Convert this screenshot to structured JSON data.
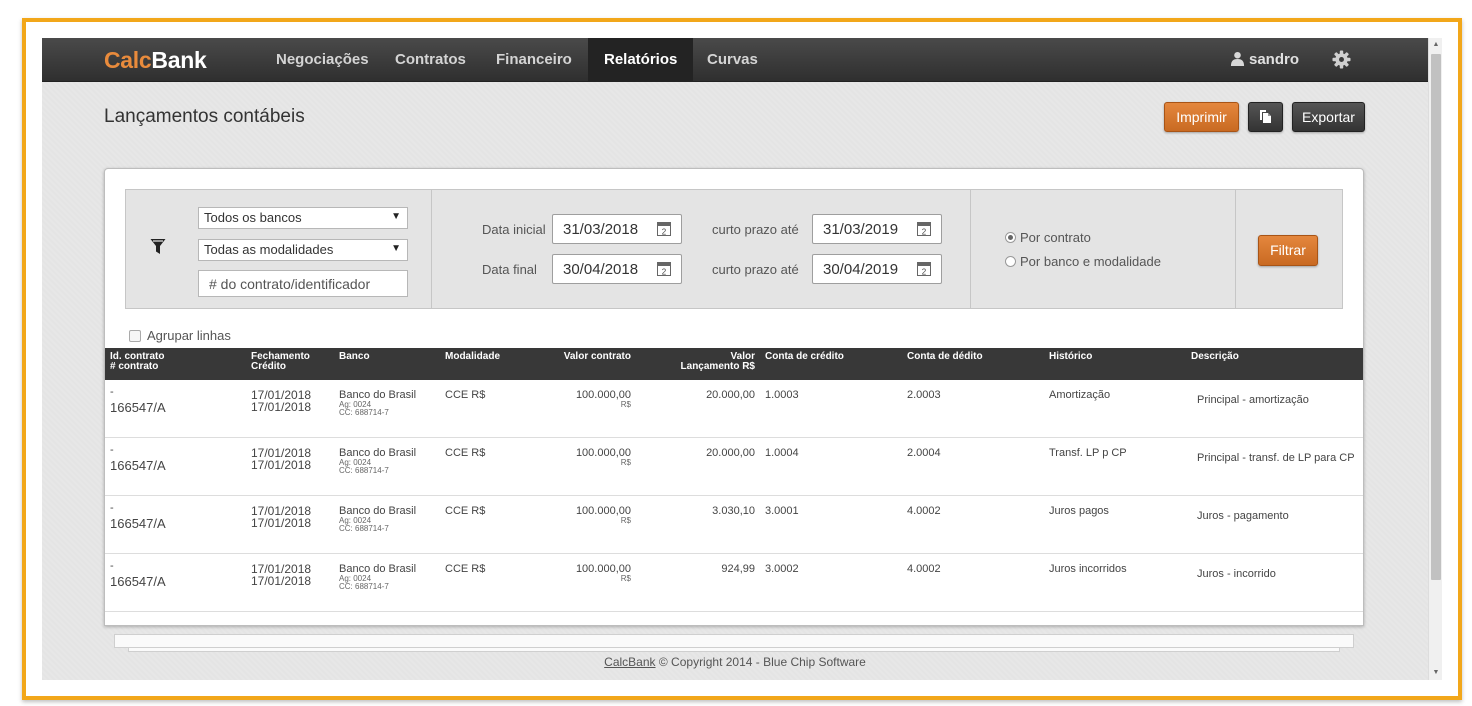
{
  "app": {
    "brand_prefix": "Calc",
    "brand_suffix": "Bank"
  },
  "nav": {
    "items": [
      {
        "label": "Negociações"
      },
      {
        "label": "Contratos"
      },
      {
        "label": "Financeiro"
      },
      {
        "label": "Relatórios"
      },
      {
        "label": "Curvas"
      }
    ],
    "active_item": "Relatórios",
    "user": "sandro"
  },
  "page": {
    "title": "Lançamentos contábeis"
  },
  "toolbar": {
    "print_label": "Imprimir",
    "export_label": "Exportar",
    "copy_icon": "copy-icon"
  },
  "filters": {
    "bank_select": "Todos os bancos",
    "modality_select": "Todas as modalidades",
    "contract_placeholder": "# do contrato/identificador",
    "start_label": "Data inicial",
    "start_date": "31/03/2018",
    "end_label": "Data final",
    "end_date": "30/04/2018",
    "short_term_label": "curto prazo até",
    "short_term_start": "31/03/2019",
    "short_term_end": "30/04/2019",
    "calendar_glyph": "2",
    "radio_by_contract": "Por contrato",
    "radio_by_bank": "Por banco e modalidade",
    "selected_radio": "Por contrato",
    "filter_button": "Filtrar",
    "group_rows_label": "Agrupar linhas"
  },
  "table": {
    "headers": {
      "id_line1": "Id. contrato",
      "id_line2": "# contrato",
      "closing_line1": "Fechamento",
      "closing_line2": "Crédito",
      "bank": "Banco",
      "modality": "Modalidade",
      "contract_value": "Valor contrato",
      "entry_value_line1": "Valor",
      "entry_value_line2": "Lançamento R$",
      "credit_account": "Conta de crédito",
      "debit_account": "Conta de dédito",
      "history": "Histórico",
      "description": "Descrição"
    },
    "rows": [
      {
        "id_prefix": "-",
        "contract": "166547/A",
        "closing": "17/01/2018",
        "credit_date": "17/01/2018",
        "bank": "Banco do Brasil",
        "agency": "Ag: 0024",
        "account": "CC: 688714-7",
        "modality": "CCE R$",
        "contract_value": "100.000,00",
        "currency": "R$",
        "entry_value": "20.000,00",
        "credit_account": "1.0003",
        "debit_account": "2.0003",
        "history": "Amortização",
        "description": "Principal - amortização"
      },
      {
        "id_prefix": "-",
        "contract": "166547/A",
        "closing": "17/01/2018",
        "credit_date": "17/01/2018",
        "bank": "Banco do Brasil",
        "agency": "Ag: 0024",
        "account": "CC: 688714-7",
        "modality": "CCE R$",
        "contract_value": "100.000,00",
        "currency": "R$",
        "entry_value": "20.000,00",
        "credit_account": "1.0004",
        "debit_account": "2.0004",
        "history": "Transf. LP p CP",
        "description": "Principal - transf. de LP para CP"
      },
      {
        "id_prefix": "-",
        "contract": "166547/A",
        "closing": "17/01/2018",
        "credit_date": "17/01/2018",
        "bank": "Banco do Brasil",
        "agency": "Ag: 0024",
        "account": "CC: 688714-7",
        "modality": "CCE R$",
        "contract_value": "100.000,00",
        "currency": "R$",
        "entry_value": "3.030,10",
        "credit_account": "3.0001",
        "debit_account": "4.0002",
        "history": "Juros pagos",
        "description": "Juros - pagamento"
      },
      {
        "id_prefix": "-",
        "contract": "166547/A",
        "closing": "17/01/2018",
        "credit_date": "17/01/2018",
        "bank": "Banco do Brasil",
        "agency": "Ag: 0024",
        "account": "CC: 688714-7",
        "modality": "CCE R$",
        "contract_value": "100.000,00",
        "currency": "R$",
        "entry_value": "924,99",
        "credit_account": "3.0002",
        "debit_account": "4.0002",
        "history": "Juros incorridos",
        "description": "Juros - incorrido"
      }
    ]
  },
  "footer": {
    "link": "CalcBank",
    "text": "© Copyright 2014 - Blue Chip Software"
  },
  "colors": {
    "accent": "#d6762c",
    "frame": "#f2a71a",
    "nav_bg": "#3a3a3a"
  }
}
